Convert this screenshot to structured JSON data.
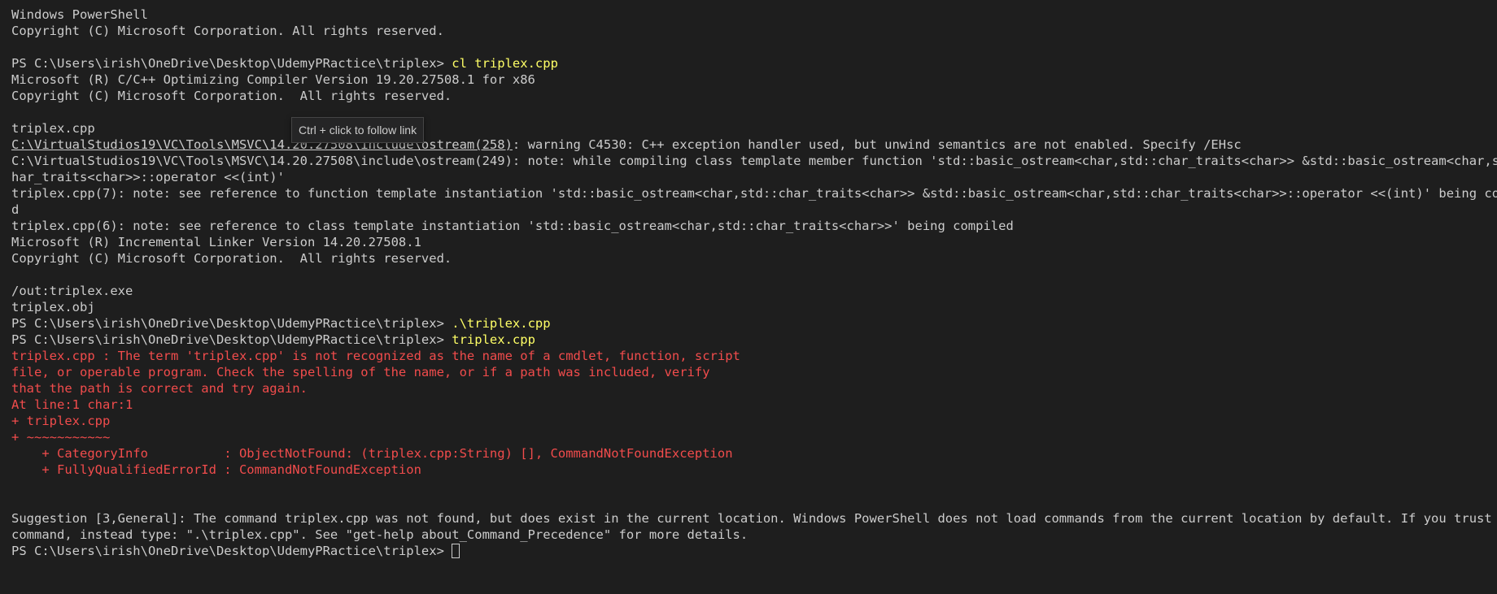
{
  "terminal": {
    "header": {
      "title": "Windows PowerShell",
      "copyright": "Copyright (C) Microsoft Corporation. All rights reserved."
    },
    "prompt": "PS C:\\Users\\irish\\OneDrive\\Desktop\\UdemyPRactice\\triplex> ",
    "command1": "cl triplex.cpp",
    "compiler": {
      "version": "Microsoft (R) C/C++ Optimizing Compiler Version 19.20.27508.1 for x86",
      "copyright": "Copyright (C) Microsoft Corporation.  All rights reserved."
    },
    "source_file": "triplex.cpp",
    "warning_link": "C:\\VirtualStudios19\\VC\\Tools\\MSVC\\14.20.27508\\include\\ostream(258)",
    "warning_rest": ": warning C4530: C++ exception handler used, but unwind semantics are not enabled. Specify /EHsc",
    "note1_part1": "C:\\VirtualStudios19\\VC\\Tools\\MSVC\\14.20.27508\\include\\ostream(249): note: while compiling class template member function 'std::basic_ostream<char,std::char_traits<char>> &std::basic_ostream<char,std::c",
    "note1_part2": "har_traits<char>>::operator <<(int)'",
    "note2_part1": "triplex.cpp(7): note: see reference to function template instantiation 'std::basic_ostream<char,std::char_traits<char>> &std::basic_ostream<char,std::char_traits<char>>::operator <<(int)' being compile",
    "note2_part2": "d",
    "note3": "triplex.cpp(6): note: see reference to class template instantiation 'std::basic_ostream<char,std::char_traits<char>>' being compiled",
    "linker": {
      "version": "Microsoft (R) Incremental Linker Version 14.20.27508.1",
      "copyright": "Copyright (C) Microsoft Corporation.  All rights reserved."
    },
    "out_line": "/out:triplex.exe",
    "obj_line": "triplex.obj",
    "command2": ".\\triplex.cpp",
    "command3": "triplex.cpp",
    "error": {
      "line1": "triplex.cpp : The term 'triplex.cpp' is not recognized as the name of a cmdlet, function, script",
      "line2": "file, or operable program. Check the spelling of the name, or if a path was included, verify",
      "line3": "that the path is correct and try again.",
      "line4": "At line:1 char:1",
      "line5": "+ triplex.cpp",
      "line6": "+ ~~~~~~~~~~~",
      "line7": "    + CategoryInfo          : ObjectNotFound: (triplex.cpp:String) [], CommandNotFoundException",
      "line8": "    + FullyQualifiedErrorId : CommandNotFoundException"
    },
    "suggestion_part1": "Suggestion [3,General]: The command triplex.cpp was not found, but does exist in the current location. Windows PowerShell does not load commands from the current location by default. If you trust this",
    "suggestion_part2": "command, instead type: \".\\triplex.cpp\". See \"get-help about_Command_Precedence\" for more details."
  },
  "tooltip": {
    "text": "Ctrl + click to follow link"
  },
  "colors": {
    "background": "#1e1e1e",
    "text": "#cccccc",
    "command": "#ffff66",
    "error": "#f14c4c"
  }
}
